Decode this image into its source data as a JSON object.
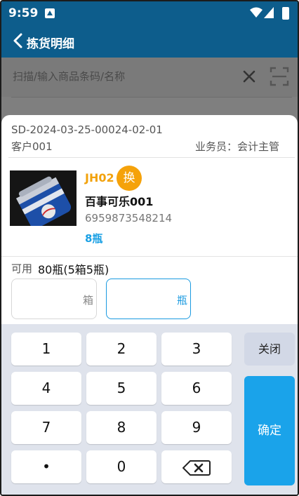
{
  "statusbar": {
    "time": "9:59"
  },
  "header": {
    "title": "拣货明细"
  },
  "search": {
    "placeholder": "扫描/输入商品条码/名称"
  },
  "popup": {
    "order_no": "SD-2024-03-25-00024-02-01",
    "customer": "客户001",
    "salesman": "业务员：会计主管",
    "product": {
      "code": "JH02",
      "swap_label": "换",
      "name": "百事可乐001",
      "barcode": "6959873548214",
      "qty": "8瓶"
    },
    "available_label": "可用",
    "available_value": "80瓶(5箱5瓶)",
    "box_unit": "箱",
    "bottle_unit": "瓶"
  },
  "keypad": {
    "keys": [
      "1",
      "2",
      "3",
      "4",
      "5",
      "6",
      "7",
      "8",
      "9",
      "•",
      "0"
    ],
    "close_label": "关闭",
    "ok_label": "确定"
  },
  "colors": {
    "header_bg": "#0d5d8c",
    "accent_orange": "#f5a20a",
    "accent_blue": "#1aa3ea"
  },
  "icons": [
    "back-arrow-icon",
    "close-icon",
    "scan-icon",
    "backspace-icon",
    "wifi-icon",
    "signal-icon",
    "battery-icon"
  ]
}
